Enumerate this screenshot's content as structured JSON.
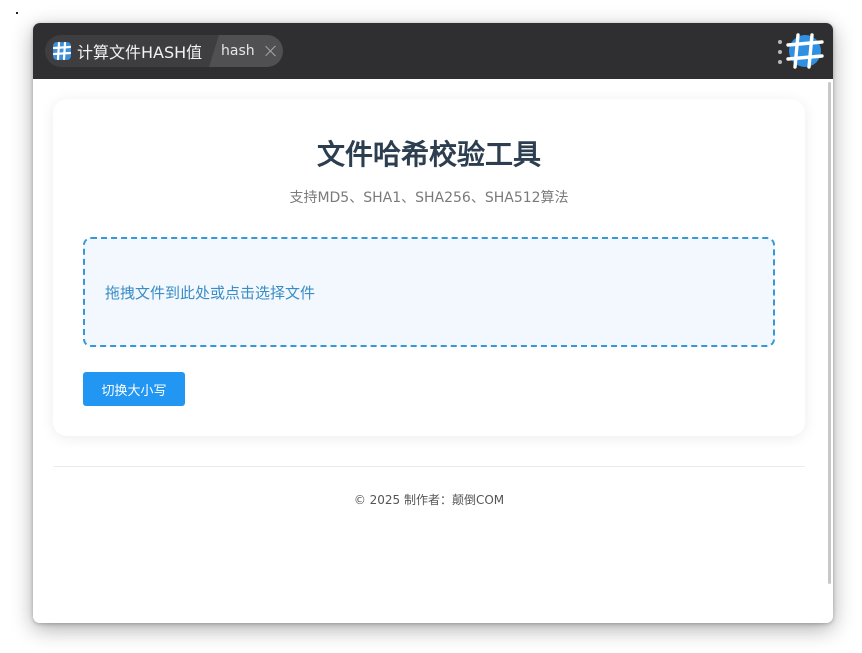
{
  "window": {
    "app_title": "计算文件HASH值",
    "tab_label": "hash",
    "app_icon": "hash-grid-icon",
    "brand_icon": "hash-globe-icon",
    "menu_icon": "more-vertical-icon"
  },
  "card": {
    "title": "文件哈希校验工具",
    "subtitle": "支持MD5、SHA1、SHA256、SHA512算法",
    "dropzone_text": "拖拽文件到此处或点击选择文件",
    "toggle_case_button": "切换大小写"
  },
  "footer": {
    "text": "© 2025 制作者：颠倒COM"
  },
  "colors": {
    "titlebar": "#2f2f31",
    "accent": "#2196f3",
    "dropzone_border": "#3498db",
    "title_text": "#2c3e50"
  }
}
